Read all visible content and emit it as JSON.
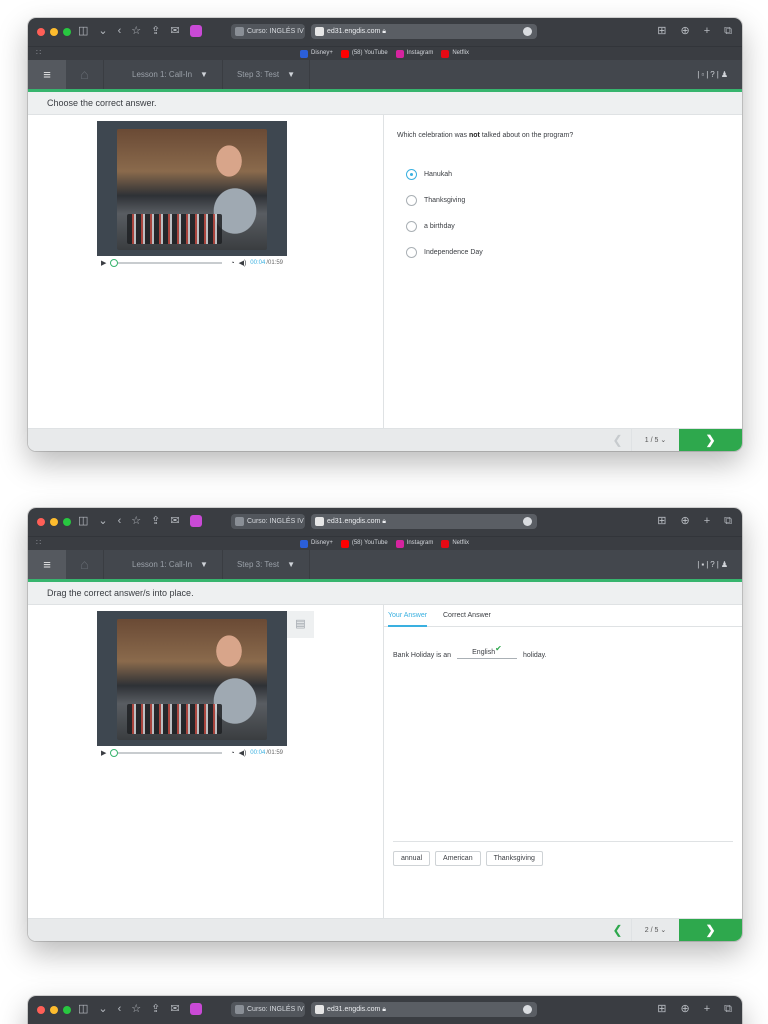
{
  "browser": {
    "tab_title": "Curso: INGLÉS IV",
    "url": "ed31.engdis.com",
    "favorites": [
      {
        "label": "Disney+",
        "color": "#2b5fd9"
      },
      {
        "label": "(58) YouTube",
        "color": "#ff0000"
      },
      {
        "label": "Instagram",
        "color": "#d6249f"
      },
      {
        "label": "Netflix",
        "color": "#e50914"
      }
    ]
  },
  "header": {
    "lesson": "Lesson 1: Call-In",
    "step": "Step 3: Test"
  },
  "media": {
    "current_time": "00:04",
    "total_time": "/01:59"
  },
  "screen1": {
    "instruction": "Choose the correct answer.",
    "question_pre": "Which celebration was ",
    "question_bold": "not",
    "question_post": " talked about on the program?",
    "options": [
      "Hanukah",
      "Thanksgiving",
      "a birthday",
      "Independence Day"
    ],
    "selected_index": 0,
    "page": "1 / 5"
  },
  "screen2": {
    "instruction": "Drag the correct answer/s into place.",
    "tabs": [
      "Your Answer",
      "Correct Answer"
    ],
    "sentence_pre": "Bank Holiday is an",
    "filled_answer": "English",
    "sentence_post": "holiday.",
    "word_bank": [
      "annual",
      "American",
      "Thanksgiving"
    ],
    "page": "2 / 5"
  },
  "colors": {
    "accent_green": "#37b56e",
    "next_green": "#2ea84d",
    "link_blue": "#3ab0e0"
  }
}
